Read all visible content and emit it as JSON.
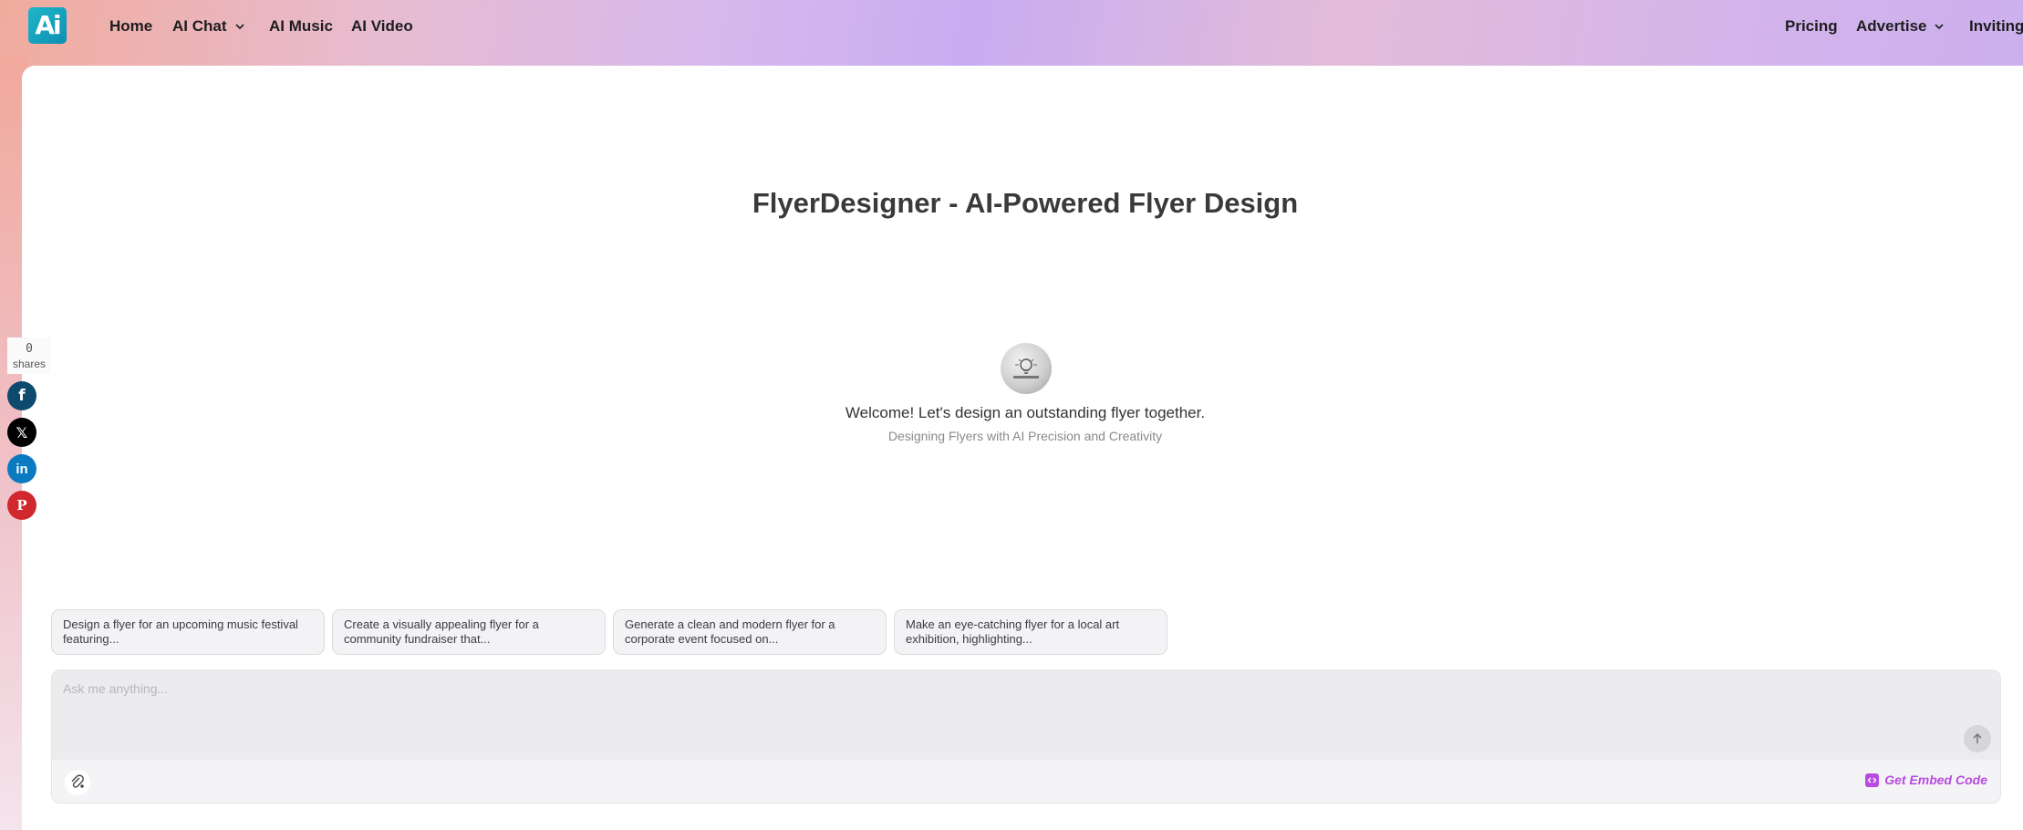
{
  "header": {
    "logo_text": "Ai",
    "nav": {
      "home": "Home",
      "ai_chat": "AI Chat",
      "ai_music": "AI Music",
      "ai_video": "AI Video",
      "pricing": "Pricing",
      "advertise": "Advertise",
      "inviting": "Inviting"
    }
  },
  "main": {
    "title": "FlyerDesigner - AI-Powered Flyer Design",
    "welcome": "Welcome! Let's design an outstanding flyer together.",
    "tagline": "Designing Flyers with AI Precision and Creativity"
  },
  "share": {
    "count": "0",
    "label": "shares",
    "facebook": "f",
    "x": "𝕏",
    "linkedin": "in",
    "pinterest": "P"
  },
  "suggestions": [
    "Design a flyer for an upcoming music festival featuring...",
    "Create a visually appealing flyer for a community fundraiser that...",
    "Generate a clean and modern flyer for a corporate event focused on...",
    "Make an eye-catching flyer for a local art exhibition, highlighting..."
  ],
  "chat": {
    "placeholder": "Ask me anything...",
    "embed_label": "Get Embed Code"
  },
  "colors": {
    "accent": "#b84be0",
    "facebook": "#0e4a6e",
    "x": "#000000",
    "linkedin": "#0a7bc1",
    "pinterest": "#d0282c"
  }
}
